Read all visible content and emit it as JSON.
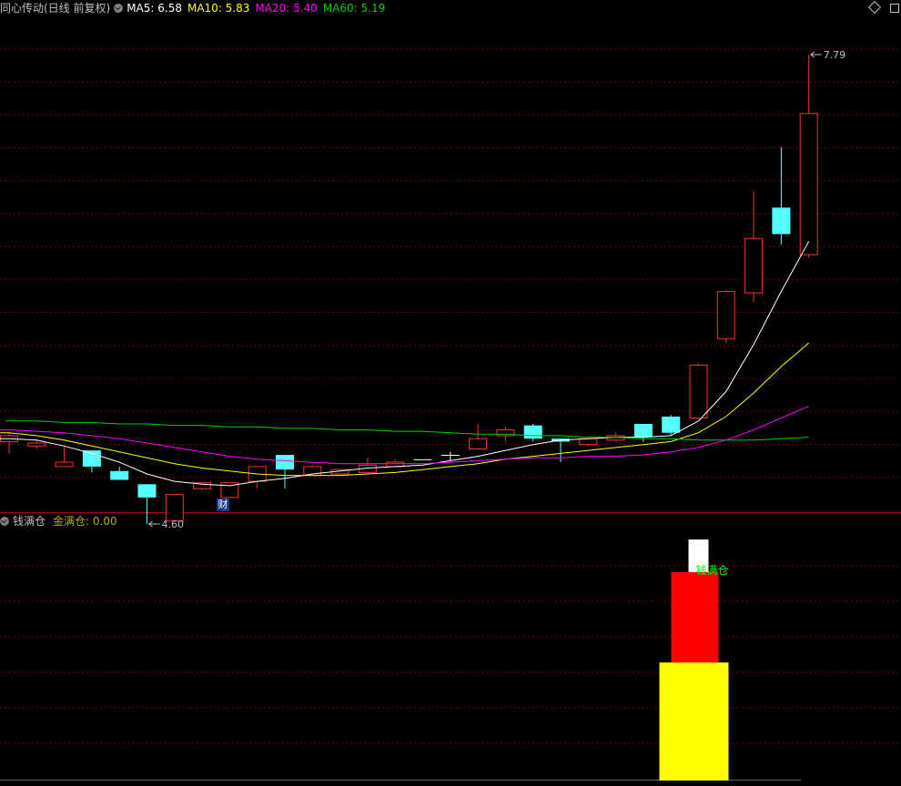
{
  "header": {
    "title": "同心传动(日线 前复权)",
    "ma5": "MA5: 6.58",
    "ma10": "MA10: 5.83",
    "ma20": "MA20: 5.40",
    "ma60": "MA60: 5.19"
  },
  "sub_header": {
    "title": "钱满仓",
    "value": "金满仓: 0.00"
  },
  "badge": "财",
  "signal_label": "钱满仓",
  "colors": {
    "up": "#ff3232",
    "down": "#54ffff",
    "flat": "#ffffff",
    "ma5": "#ffffff",
    "ma10": "#ffff00",
    "ma20": "#ff00ff",
    "ma60": "#00cc00",
    "grid": "#800000",
    "separator": "#b00000",
    "bar_white": "#ffffff",
    "bar_red": "#ff0000",
    "bar_yellow": "#ffff00",
    "signal_text": "#00ff00"
  },
  "chart_data": [
    {
      "type": "candlestick",
      "title": "同心传动(日线 前复权)",
      "ylim": [
        4.45,
        7.95
      ],
      "annotations": [
        {
          "candle_index": 5,
          "price": 4.6,
          "text": "4.60"
        },
        {
          "candle_index": 29,
          "price": 7.79,
          "text": "7.79"
        }
      ],
      "candles": [
        {
          "o": 5.16,
          "c": 5.2,
          "h": 5.22,
          "l": 5.08
        },
        {
          "o": 5.13,
          "c": 5.15,
          "h": 5.17,
          "l": 5.11
        },
        {
          "o": 4.99,
          "c": 5.02,
          "h": 5.13,
          "l": 4.99
        },
        {
          "o": 5.1,
          "c": 4.99,
          "h": 5.1,
          "l": 4.95
        },
        {
          "o": 4.96,
          "c": 4.9,
          "h": 4.99,
          "l": 4.9
        },
        {
          "o": 4.87,
          "c": 4.78,
          "h": 4.87,
          "l": 4.6
        },
        {
          "o": 4.62,
          "c": 4.8,
          "h": 4.8,
          "l": 4.62
        },
        {
          "o": 4.84,
          "c": 4.88,
          "h": 4.88,
          "l": 4.83
        },
        {
          "o": 4.78,
          "c": 4.88,
          "h": 4.88,
          "l": 4.78
        },
        {
          "o": 4.89,
          "c": 4.99,
          "h": 4.99,
          "l": 4.84
        },
        {
          "o": 5.07,
          "c": 4.97,
          "h": 5.07,
          "l": 4.84
        },
        {
          "o": 4.93,
          "c": 4.99,
          "h": 5.0,
          "l": 4.93
        },
        {
          "o": 4.94,
          "c": 4.97,
          "h": 4.97,
          "l": 4.94
        },
        {
          "o": 4.95,
          "c": 5.0,
          "h": 5.05,
          "l": 4.95
        },
        {
          "o": 4.99,
          "c": 5.02,
          "h": 5.04,
          "l": 4.99
        },
        {
          "o": 5.04,
          "c": 5.04,
          "h": 5.04,
          "l": 5.04
        },
        {
          "o": 5.07,
          "c": 5.07,
          "h": 5.09,
          "l": 5.03
        },
        {
          "o": 5.11,
          "c": 5.18,
          "h": 5.28,
          "l": 5.11
        },
        {
          "o": 5.2,
          "c": 5.24,
          "h": 5.26,
          "l": 5.16
        },
        {
          "o": 5.27,
          "c": 5.18,
          "h": 5.28,
          "l": 5.16
        },
        {
          "o": 5.18,
          "c": 5.16,
          "h": 5.18,
          "l": 5.02
        },
        {
          "o": 5.14,
          "c": 5.18,
          "h": 5.18,
          "l": 5.13
        },
        {
          "o": 5.17,
          "c": 5.2,
          "h": 5.22,
          "l": 5.16
        },
        {
          "o": 5.28,
          "c": 5.19,
          "h": 5.28,
          "l": 5.16
        },
        {
          "o": 5.33,
          "c": 5.22,
          "h": 5.34,
          "l": 5.2
        },
        {
          "o": 5.32,
          "c": 5.68,
          "h": 5.69,
          "l": 5.32
        },
        {
          "o": 5.86,
          "c": 6.18,
          "h": 6.19,
          "l": 5.83
        },
        {
          "o": 6.17,
          "c": 6.54,
          "h": 6.86,
          "l": 6.11
        },
        {
          "o": 6.75,
          "c": 6.57,
          "h": 7.16,
          "l": 6.5
        },
        {
          "o": 6.43,
          "c": 7.39,
          "h": 7.79,
          "l": 6.41
        }
      ],
      "series": [
        {
          "name": "MA5",
          "values": [
            5.18,
            5.17,
            5.13,
            5.08,
            5.02,
            4.94,
            4.89,
            4.87,
            4.86,
            4.89,
            4.91,
            4.94,
            4.96,
            4.98,
            4.99,
            5.0,
            5.03,
            5.06,
            5.1,
            5.14,
            5.17,
            5.18,
            5.19,
            5.19,
            5.2,
            5.3,
            5.5,
            5.82,
            6.18,
            6.52
          ]
        },
        {
          "name": "MA10",
          "values": [
            5.22,
            5.2,
            5.17,
            5.13,
            5.09,
            5.05,
            5.01,
            4.98,
            4.96,
            4.94,
            4.93,
            4.93,
            4.93,
            4.94,
            4.95,
            4.97,
            4.99,
            5.01,
            5.04,
            5.06,
            5.08,
            5.1,
            5.12,
            5.14,
            5.16,
            5.22,
            5.33,
            5.49,
            5.67,
            5.83
          ]
        },
        {
          "name": "MA20",
          "values": [
            5.24,
            5.23,
            5.22,
            5.2,
            5.18,
            5.15,
            5.12,
            5.09,
            5.06,
            5.04,
            5.03,
            5.02,
            5.01,
            5.01,
            5.01,
            5.01,
            5.02,
            5.03,
            5.04,
            5.05,
            5.05,
            5.06,
            5.06,
            5.07,
            5.09,
            5.12,
            5.17,
            5.24,
            5.32,
            5.4
          ]
        },
        {
          "name": "MA60",
          "values": [
            5.3,
            5.3,
            5.29,
            5.29,
            5.28,
            5.28,
            5.27,
            5.27,
            5.26,
            5.26,
            5.25,
            5.25,
            5.24,
            5.24,
            5.23,
            5.23,
            5.22,
            5.21,
            5.21,
            5.2,
            5.2,
            5.19,
            5.19,
            5.18,
            5.18,
            5.17,
            5.17,
            5.17,
            5.18,
            5.19
          ]
        }
      ]
    },
    {
      "type": "bar",
      "title": "钱满仓",
      "ylim": [
        0,
        100
      ],
      "bars": [
        {
          "name": "white",
          "candle_index": 25,
          "bottom": 83,
          "top": 96
        },
        {
          "name": "red",
          "candle_index": 25,
          "bottom": 47,
          "top": 83
        },
        {
          "name": "yellow",
          "candle_index": 25,
          "bottom": 0,
          "top": 47
        }
      ]
    }
  ]
}
